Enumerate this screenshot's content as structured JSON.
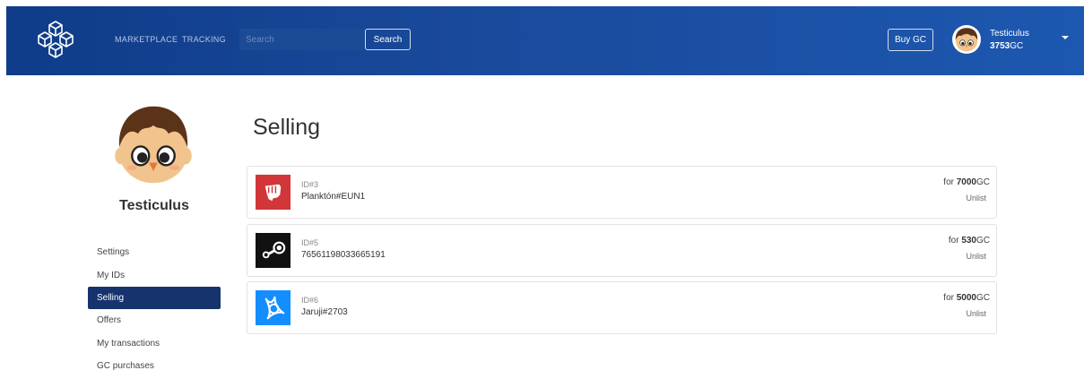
{
  "header": {
    "nav": {
      "marketplace": "MARKETPLACE",
      "tracking": "TRACKING"
    },
    "search": {
      "placeholder": "Search",
      "button_label": "Search"
    },
    "buy_label": "Buy GC",
    "user": {
      "name": "Testiculus",
      "balance_value": "3753",
      "balance_unit": "GC"
    }
  },
  "sidebar": {
    "name": "Testiculus",
    "items": [
      {
        "label": "Settings",
        "active": false
      },
      {
        "label": "My IDs",
        "active": false
      },
      {
        "label": "Selling",
        "active": true
      },
      {
        "label": "Offers",
        "active": false
      },
      {
        "label": "My transactions",
        "active": false
      },
      {
        "label": "GC purchases",
        "active": false
      }
    ]
  },
  "main": {
    "title": "Selling",
    "listings": [
      {
        "id_label": "ID#3",
        "name": "Planktón#EUN1",
        "price_prefix": "for ",
        "price_value": "7000",
        "price_unit": "GC",
        "action": "Unlist",
        "icon": "riot-fist-icon",
        "icon_bg": "#d13639"
      },
      {
        "id_label": "ID#5",
        "name": "76561198033665191",
        "price_prefix": "for ",
        "price_value": "530",
        "price_unit": "GC",
        "action": "Unlist",
        "icon": "steam-icon",
        "icon_bg": "#111111"
      },
      {
        "id_label": "ID#6",
        "name": "Jaruji#2703",
        "price_prefix": "for ",
        "price_value": "5000",
        "price_unit": "GC",
        "action": "Unlist",
        "icon": "battlenet-icon",
        "icon_bg": "#148eff"
      }
    ]
  },
  "colors": {
    "header_start": "#0f3c88",
    "header_end": "#1c58b0",
    "active_item": "#16336e"
  }
}
